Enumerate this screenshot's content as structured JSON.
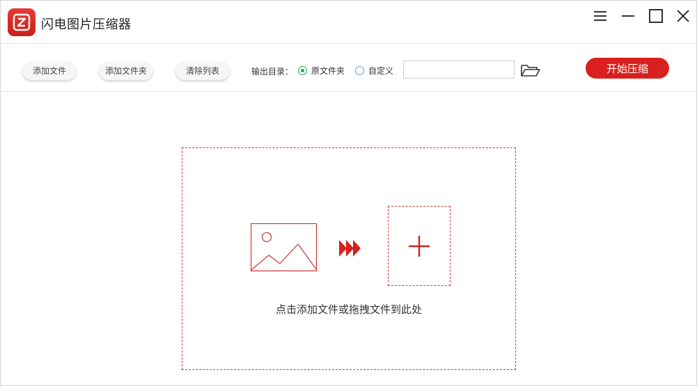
{
  "app": {
    "title": "闪电图片压缩器"
  },
  "titlebar": {
    "menu_icon": "hamburger-icon",
    "minimize_icon": "minimize-icon",
    "maximize_icon": "maximize-icon",
    "close_icon": "close-icon"
  },
  "toolbar": {
    "add_file_label": "添加文件",
    "add_folder_label": "添加文件夹",
    "clear_list_label": "清除列表",
    "output_dir_label": "输出目录：",
    "radio_original_label": "原文件夹",
    "radio_custom_label": "自定义",
    "selected_output": "原文件夹",
    "path_value": "",
    "folder_icon": "folder-open-icon",
    "start_label": "开始压缩"
  },
  "dropzone": {
    "hint": "点击添加文件或拖拽文件到此处",
    "image_icon": "image-icon",
    "arrows_icon": "triple-arrow-icon",
    "plus_icon": "plus-icon"
  },
  "colors": {
    "accent": "#d9201e",
    "radio_selected": "#2aa548"
  }
}
